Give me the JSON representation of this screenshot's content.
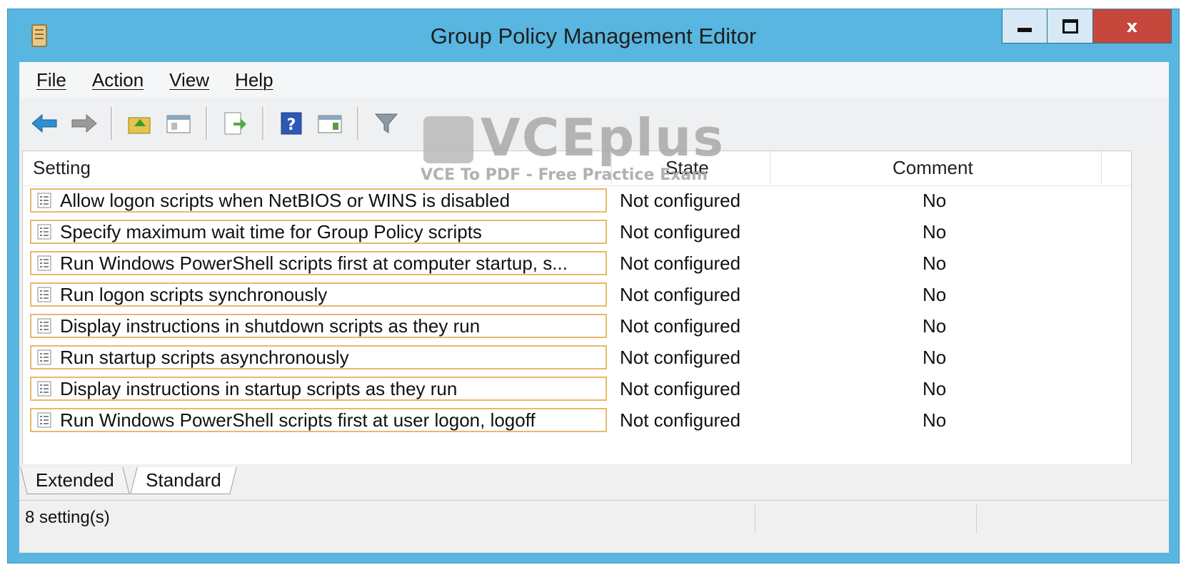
{
  "window": {
    "title": "Group Policy Management Editor",
    "app_icon": "gpo-editor-icon",
    "close_label": "x"
  },
  "menu": [
    {
      "label": "File"
    },
    {
      "label": "Action"
    },
    {
      "label": "View"
    },
    {
      "label": "Help"
    }
  ],
  "toolbar": {
    "icons": [
      "back-arrow-icon",
      "forward-arrow-icon",
      "up-folder-icon",
      "show-hide-tree-icon",
      "export-list-icon",
      "help-icon",
      "show-action-pane-icon",
      "filter-icon"
    ]
  },
  "watermark": {
    "brand": "VCEplus",
    "tagline": "VCE To PDF - Free Practice Exam"
  },
  "table": {
    "headers": {
      "setting": "Setting",
      "state": "State",
      "comment": "Comment"
    },
    "rows": [
      {
        "setting": "Allow logon scripts when NetBIOS or WINS is disabled",
        "state": "Not configured",
        "comment": "No"
      },
      {
        "setting": "Specify maximum wait time for Group Policy scripts",
        "state": "Not configured",
        "comment": "No"
      },
      {
        "setting": "Run Windows PowerShell scripts first at computer startup, s...",
        "state": "Not configured",
        "comment": "No"
      },
      {
        "setting": "Run logon scripts synchronously",
        "state": "Not configured",
        "comment": "No"
      },
      {
        "setting": "Display instructions in shutdown scripts as they run",
        "state": "Not configured",
        "comment": "No"
      },
      {
        "setting": "Run startup scripts asynchronously",
        "state": "Not configured",
        "comment": "No"
      },
      {
        "setting": "Display instructions in startup scripts as they run",
        "state": "Not configured",
        "comment": "No"
      },
      {
        "setting": "Run Windows PowerShell scripts first at user logon, logoff",
        "state": "Not configured",
        "comment": "No"
      }
    ]
  },
  "tabs": [
    {
      "label": "Extended"
    },
    {
      "label": "Standard",
      "selected": true
    }
  ],
  "status": {
    "count_text": "8 setting(s)"
  }
}
